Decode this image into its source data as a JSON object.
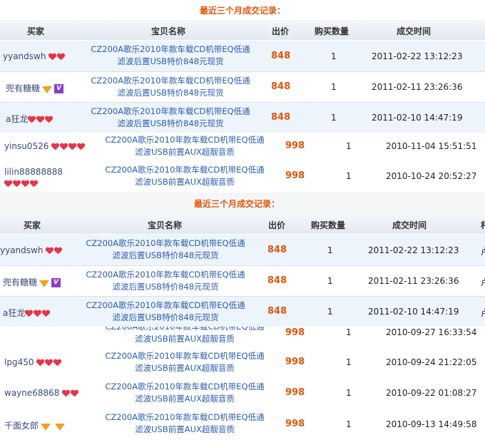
{
  "title": "最近三个月成交记录：",
  "headers": {
    "buyer": "买家",
    "item": "宝贝名称",
    "price": "出价",
    "qty": "购买数量",
    "time": "成交时间",
    "extra": "朽"
  },
  "item_line1": "CZ200A歌乐2010年款车载CD机带EQ低通",
  "item_line2_a": "滤波后置USB特价848元现货",
  "item_line2_b": "滤波USB前置AUX超靓音质",
  "section1": {
    "rows": [
      {
        "buyer": "yyandswh",
        "badges": "hearts2",
        "price": "848",
        "qty": "1",
        "time": "2011-02-22 13:12:23"
      },
      {
        "buyer": "兜有糖糖",
        "badges": "diamond-v",
        "price": "848",
        "qty": "1",
        "time": "2011-02-11 23:26:36"
      },
      {
        "buyer": "a狂龙",
        "badges": "hearts3",
        "price": "848",
        "qty": "1",
        "time": "2011-02-10 14:47:19"
      },
      {
        "buyer": "yinsu0526",
        "badges": "hearts4",
        "price": "998",
        "qty": "1",
        "time": "2010-11-04 15:51:51"
      },
      {
        "buyer": "lilin88888888",
        "badges": "hearts4",
        "price": "998",
        "qty": "1",
        "time": "2010-10-24 20:52:27"
      }
    ]
  },
  "section2": {
    "rows": [
      {
        "buyer": "yyandswh",
        "price": "848",
        "qty": "1",
        "time": "2011-02-22 13:12:23",
        "tail": "卢"
      },
      {
        "buyer": "兜有糖糖",
        "price": "848",
        "qty": "1",
        "time": "2011-02-11 23:26:36",
        "tail": "卢"
      },
      {
        "buyer": "a狂龙",
        "price": "848",
        "qty": "1",
        "time": "2011-02-10 14:47:19",
        "tail": "卢"
      },
      {
        "buyer": "",
        "price": "998",
        "qty": "1",
        "time": "2010-09-27 16:33:54"
      },
      {
        "buyer": "lpg450",
        "price": "998",
        "qty": "1",
        "time": "2010-09-24 21:22:05"
      },
      {
        "buyer": "wayne68868",
        "price": "998",
        "qty": "1",
        "time": "2010-09-22 01:08:27"
      },
      {
        "buyer": "千面女郎",
        "price": "998",
        "qty": "1",
        "time": "2010-09-13 14:49:58"
      }
    ]
  }
}
